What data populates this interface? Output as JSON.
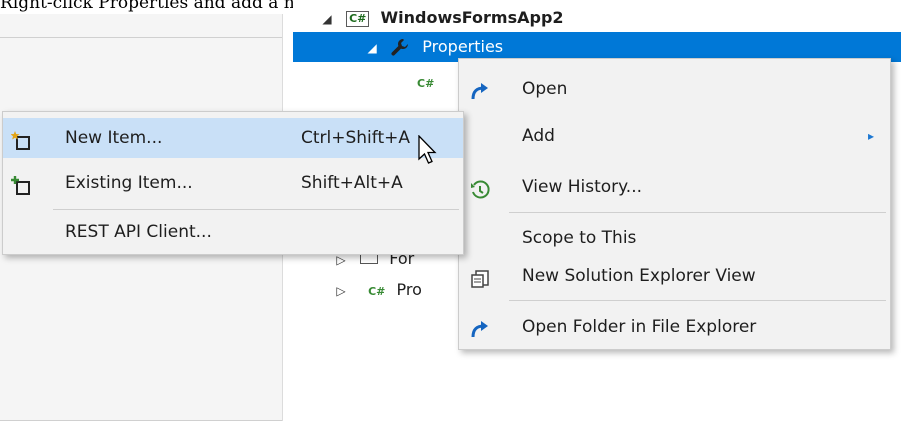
{
  "caption": "Right-click Properties and add a new item.",
  "tree": {
    "project": "WindowsFormsApp2",
    "project_badge": "C#",
    "properties": "Properties",
    "child_badge": "C#",
    "row_form_prefix": "For",
    "row_program_prefix": "Pro"
  },
  "context_menu": {
    "items": [
      {
        "label": "Open",
        "icon": "open-arrow-icon"
      },
      {
        "label": "Add",
        "icon": ""
      },
      {
        "label": "View History...",
        "icon": "history-icon"
      },
      {
        "label": "Scope to This",
        "icon": ""
      },
      {
        "label": "New Solution Explorer View",
        "icon": "new-view-icon"
      },
      {
        "label": "Open Folder in File Explorer",
        "icon": "open-arrow-icon"
      }
    ],
    "submenu_arrow": "▸"
  },
  "add_submenu": {
    "items": [
      {
        "label": "New Item...",
        "shortcut": "Ctrl+Shift+A",
        "icon": "new-item-icon"
      },
      {
        "label": "Existing Item...",
        "shortcut": "Shift+Alt+A",
        "icon": "existing-item-icon"
      },
      {
        "label": "REST API Client...",
        "shortcut": "",
        "icon": ""
      }
    ]
  },
  "colors": {
    "selection": "#0078d7",
    "hover": "#c9e0f7",
    "menu_bg": "#f2f2f2",
    "accent_arrow": "#1e78d2",
    "green": "#388a34"
  }
}
